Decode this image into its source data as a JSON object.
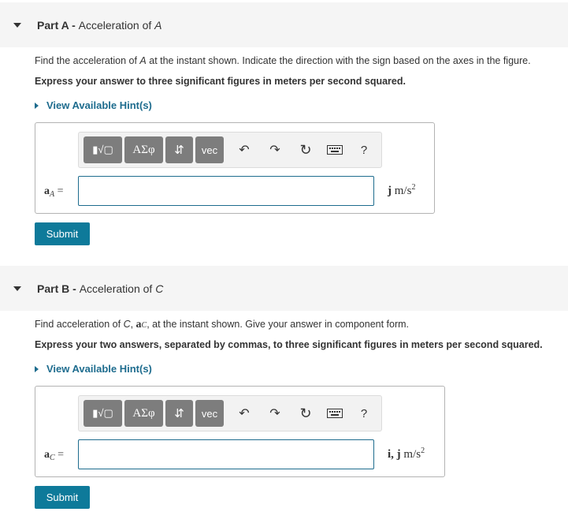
{
  "part_a": {
    "label": "Part A - ",
    "title_pre": "Acceleration of ",
    "title_var": "A",
    "prompt_pre": "Find the acceleration of ",
    "prompt_var": "A",
    "prompt_post": " at the instant shown. Indicate the direction with the sign based on the axes in the figure.",
    "instruction": "Express your answer to three significant figures in meters per second squared.",
    "hint": "View Available Hint(s)",
    "eq_symbol": "a",
    "eq_sub": "A",
    "eq_sign": " =",
    "input_value": "",
    "unit_vec": "j",
    "unit_main": " m/s",
    "unit_exp": "2",
    "submit": "Submit"
  },
  "part_b": {
    "label": "Part B - ",
    "title_pre": "Acceleration of ",
    "title_var": "C",
    "prompt_pre": "Find acceleration of ",
    "prompt_var": "C",
    "prompt_sep": ", ",
    "prompt_sym": "a",
    "prompt_sym_sub": "C",
    "prompt_post": ", at the instant shown. Give your answer in component form.",
    "instruction": "Express your two answers, separated by commas, to three significant figures in meters per second squared.",
    "hint": "View Available Hint(s)",
    "eq_symbol": "a",
    "eq_sub": "C",
    "eq_sign": " =",
    "input_value": "",
    "unit_vec": "i, j",
    "unit_main": " m/s",
    "unit_exp": "2",
    "submit": "Submit"
  },
  "toolbar": {
    "templates_label": "▮√▢",
    "symbols_label": "ΑΣφ",
    "arrows_label": "⇵",
    "vec_label": "vec",
    "undo_glyph": "↶",
    "redo_glyph": "↷",
    "reset_glyph": "↻",
    "help_label": "?"
  },
  "icons": [
    "caret-down-icon",
    "caret-right-icon",
    "undo-icon",
    "redo-icon",
    "reset-icon",
    "keyboard-icon",
    "help-icon"
  ],
  "colors": {
    "accent": "#0e7a9a",
    "link": "#1e6c8e",
    "header_bg": "#f5f5f5",
    "tool_button": "#7d7d7d"
  }
}
